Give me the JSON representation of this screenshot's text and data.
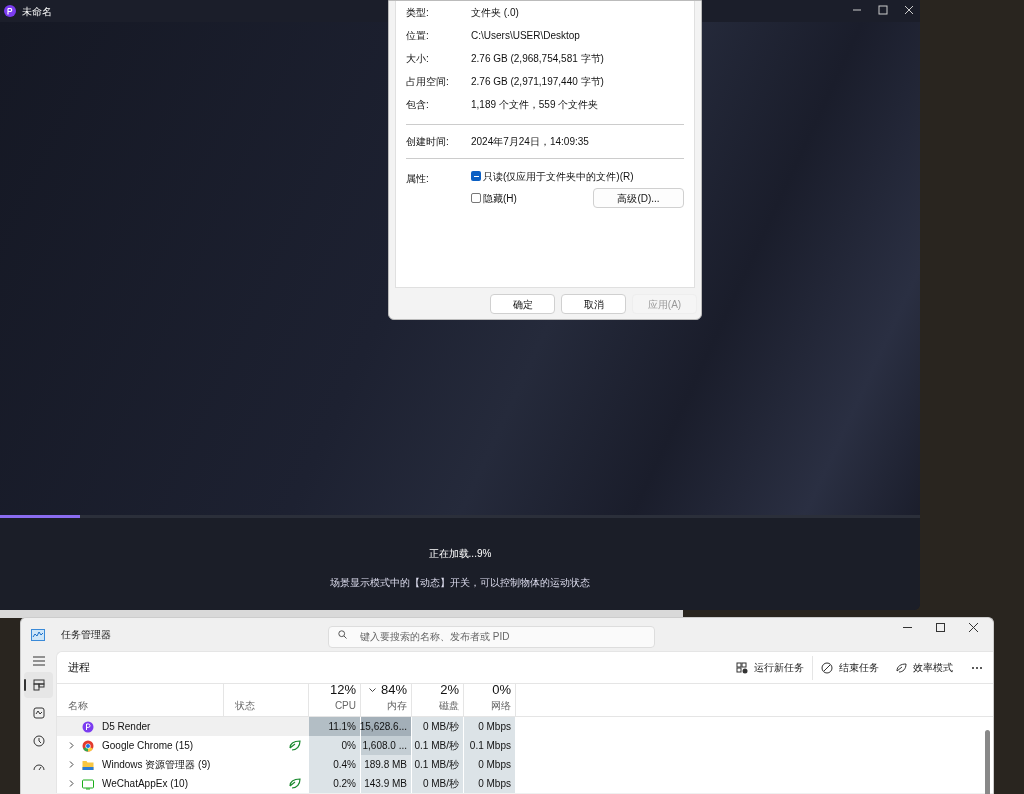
{
  "app_window": {
    "title": "未命名",
    "loading": {
      "level": 0.087,
      "text": "正在加载...9%",
      "tip": "场景显示模式中的【动态】开关，可以控制物体的运动状态"
    }
  },
  "properties_dialog": {
    "fields": [
      {
        "label": "类型:",
        "value": "文件夹 (.0)"
      },
      {
        "label": "位置:",
        "value": "C:\\Users\\USER\\Desktop"
      },
      {
        "label": "大小:",
        "value": "2.76 GB (2,968,754,581 字节)"
      },
      {
        "label": "占用空间:",
        "value": "2.76 GB (2,971,197,440 字节)"
      },
      {
        "label": "包含:",
        "value": "1,189 个文件，559 个文件夹"
      }
    ],
    "created": {
      "label": "创建时间:",
      "value": "2024年7月24日，14:09:35"
    },
    "attributes_label": "属性:",
    "attributes": [
      {
        "label": "只读(仅应用于文件夹中的文件)(R)",
        "checked": true,
        "partial": true
      },
      {
        "label": "隐藏(H)",
        "checked": false,
        "partial": false
      }
    ],
    "advanced_button": "高级(D)...",
    "buttons": [
      {
        "label": "确定",
        "disabled": false
      },
      {
        "label": "取消",
        "disabled": false
      },
      {
        "label": "应用(A)",
        "disabled": true
      }
    ]
  },
  "task_manager": {
    "title": "任务管理器",
    "search": {
      "placeholder": "键入要搜索的名称、发布者或 PID"
    },
    "nav": [
      {
        "selected": true
      },
      {
        "selected": false
      },
      {
        "selected": false
      },
      {
        "selected": false
      }
    ],
    "page_title": "进程",
    "actions": [
      {
        "label": "运行新任务"
      },
      {
        "label": "结束任务"
      },
      {
        "label": "效率模式"
      }
    ],
    "columns": [
      {
        "label": "名称"
      },
      {
        "label": "状态"
      },
      {
        "label": "CPU",
        "total": "12%",
        "sorted": false
      },
      {
        "label": "内存",
        "total": "84%",
        "sorted": true
      },
      {
        "label": "磁盘",
        "total": "2%",
        "sorted": false
      },
      {
        "label": "网络",
        "total": "0%",
        "sorted": false
      }
    ],
    "rows": [
      {
        "expandable": false,
        "selected": true,
        "efficiency_mode": false,
        "cells": [
          {
            "text": "D5 Render"
          },
          {
            "text": ""
          },
          {
            "text": "11.1%",
            "color": "#b3bec5"
          },
          {
            "text": "15,628.6...",
            "color": "#a3afb8"
          },
          {
            "text": "0 MB/秒",
            "color": "#dce3e7"
          },
          {
            "text": "0 Mbps",
            "color": "#dce3e7"
          }
        ]
      },
      {
        "expandable": true,
        "selected": false,
        "efficiency_mode": true,
        "cells": [
          {
            "text": "Google Chrome (15)"
          },
          {
            "text": ""
          },
          {
            "text": "0%",
            "color": "#dce3e7"
          },
          {
            "text": "1,608.0 ...",
            "color": "#c4ced4"
          },
          {
            "text": "0.1 MB/秒",
            "color": "#dce3e7"
          },
          {
            "text": "0.1 Mbps",
            "color": "#dce3e7"
          }
        ]
      },
      {
        "expandable": true,
        "selected": false,
        "efficiency_mode": false,
        "cells": [
          {
            "text": "Windows 资源管理器 (9)"
          },
          {
            "text": ""
          },
          {
            "text": "0.4%",
            "color": "#dce3e7"
          },
          {
            "text": "189.8 MB",
            "color": "#dce3e7"
          },
          {
            "text": "0.1 MB/秒",
            "color": "#dce3e7"
          },
          {
            "text": "0 Mbps",
            "color": "#dce3e7"
          }
        ]
      },
      {
        "expandable": true,
        "selected": false,
        "efficiency_mode": true,
        "cells": [
          {
            "text": "WeChatAppEx (10)"
          },
          {
            "text": ""
          },
          {
            "text": "0.2%",
            "color": "#dce3e7"
          },
          {
            "text": "143.9 MB",
            "color": "#dce3e7"
          },
          {
            "text": "0 MB/秒",
            "color": "#dce3e7"
          },
          {
            "text": "0 Mbps",
            "color": "#dce3e7"
          }
        ]
      }
    ]
  }
}
